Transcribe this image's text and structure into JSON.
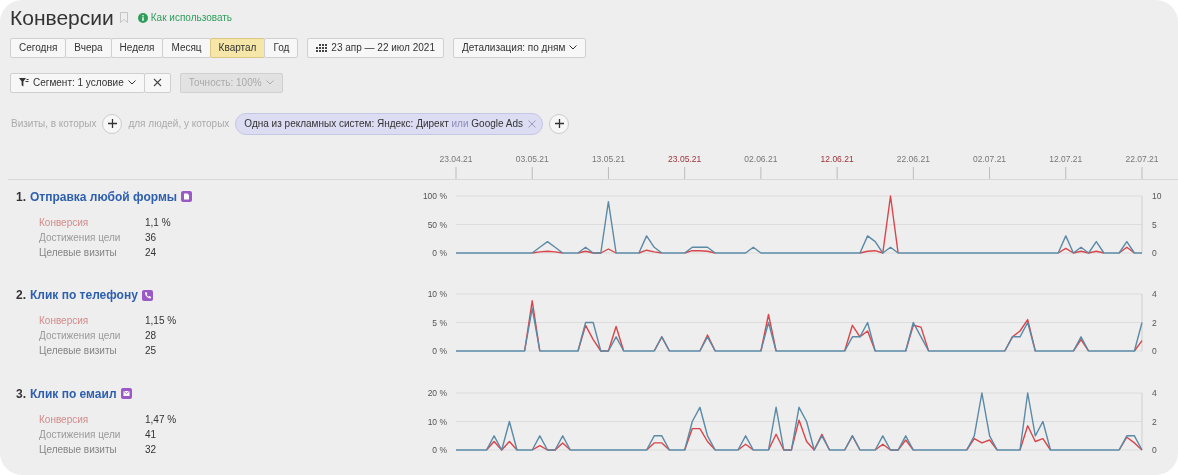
{
  "page": {
    "title": "Конверсии",
    "help_link": "Как использовать"
  },
  "periods": [
    {
      "label": "Сегодня",
      "selected": false
    },
    {
      "label": "Вчера",
      "selected": false
    },
    {
      "label": "Неделя",
      "selected": false
    },
    {
      "label": "Месяц",
      "selected": false
    },
    {
      "label": "Квартал",
      "selected": true
    },
    {
      "label": "Год",
      "selected": false
    }
  ],
  "date_range": "23 апр — 22 июл 2021",
  "detail": "Детализация: по дням",
  "segment": {
    "label": "Сегмент: 1 условие"
  },
  "precision": {
    "label": "Точность: 100%",
    "disabled": true
  },
  "filter": {
    "visits_label": "Визиты, в которых",
    "people_label": "для людей, у которых",
    "chip": [
      {
        "text": "Одна из рекламных систем: Яндекс: Директ",
        "kind": "value"
      },
      {
        "text": "или",
        "kind": "connector"
      },
      {
        "text": "Google Ads",
        "kind": "value"
      }
    ]
  },
  "date_axis": {
    "ticks": [
      {
        "label": "23.04.21",
        "holiday": false
      },
      {
        "label": "03.05.21",
        "holiday": false
      },
      {
        "label": "13.05.21",
        "holiday": false
      },
      {
        "label": "23.05.21",
        "holiday": true
      },
      {
        "label": "02.06.21",
        "holiday": false
      },
      {
        "label": "12.06.21",
        "holiday": true
      },
      {
        "label": "22.06.21",
        "holiday": false
      },
      {
        "label": "02.07.21",
        "holiday": false
      },
      {
        "label": "12.07.21",
        "holiday": false
      },
      {
        "label": "22.07.21",
        "holiday": false
      }
    ]
  },
  "goals": [
    {
      "number": "1.",
      "title": "Отправка любой формы",
      "kind": "form",
      "metrics": [
        {
          "label": "Конверсия",
          "value": "1,1 %",
          "color": "#d48a8a"
        },
        {
          "label": "Достижения цели",
          "value": "36",
          "color": "#9a9a9a"
        },
        {
          "label": "Целевые визиты",
          "value": "24",
          "color": "#858585"
        }
      ],
      "chart_data": {
        "type": "line",
        "ylim": [
          0,
          100
        ],
        "yticks": [
          {
            "value": 0,
            "label": "0 %"
          },
          {
            "value": 50,
            "label": "50 %"
          },
          {
            "value": 100,
            "label": "100 %"
          }
        ],
        "y2lim": [
          0,
          10
        ],
        "y2ticks": [
          0,
          5,
          10
        ],
        "series": [
          {
            "color": "#d9454a",
            "values": [
              null,
              null,
              null,
              null,
              null,
              null,
              null,
              null,
              null,
              null,
              0,
              2,
              3,
              2,
              0,
              null,
              0,
              3,
              0,
              0,
              7,
              0,
              null,
              null,
              0,
              5,
              2,
              0,
              null,
              null,
              0,
              4,
              4,
              3,
              0,
              null,
              null,
              null,
              null,
              null,
              null,
              null,
              null,
              null,
              null,
              null,
              null,
              null,
              null,
              null,
              null,
              null,
              null,
              0,
              3,
              4,
              0,
              100,
              0,
              null,
              null,
              null,
              null,
              null,
              null,
              null,
              null,
              null,
              null,
              null,
              null,
              null,
              null,
              null,
              null,
              null,
              null,
              null,
              null,
              0,
              8,
              0,
              3,
              0,
              3,
              0,
              null,
              0,
              10,
              0,
              null
            ]
          },
          {
            "color": "#5b8aa6",
            "axis": "y2",
            "values": [
              0,
              0,
              0,
              0,
              0,
              0,
              0,
              0,
              0,
              0,
              0,
              1,
              2,
              1,
              0,
              0,
              0,
              1,
              0,
              0,
              9,
              0,
              0,
              0,
              0,
              3,
              1,
              0,
              0,
              0,
              0,
              1,
              1,
              1,
              0,
              0,
              0,
              0,
              0,
              1,
              0,
              0,
              0,
              0,
              0,
              0,
              0,
              0,
              0,
              0,
              0,
              0,
              0,
              0,
              3,
              2,
              0,
              1,
              0,
              0,
              0,
              0,
              0,
              0,
              0,
              0,
              0,
              0,
              0,
              0,
              0,
              0,
              0,
              0,
              0,
              0,
              0,
              0,
              0,
              0,
              3,
              0,
              1,
              0,
              2,
              0,
              0,
              0,
              2,
              0,
              0
            ]
          }
        ]
      }
    },
    {
      "number": "2.",
      "title": "Клик по телефону",
      "kind": "phone",
      "metrics": [
        {
          "label": "Конверсия",
          "value": "1,15 %",
          "color": "#d48a8a"
        },
        {
          "label": "Достижения цели",
          "value": "28",
          "color": "#9a9a9a"
        },
        {
          "label": "Целевые визиты",
          "value": "25",
          "color": "#858585"
        }
      ],
      "chart_data": {
        "type": "line",
        "ylim": [
          0,
          10
        ],
        "yticks": [
          {
            "value": 0,
            "label": "0 %"
          },
          {
            "value": 5,
            "label": "5 %"
          },
          {
            "value": 10,
            "label": "10 %"
          }
        ],
        "y2lim": [
          0,
          4
        ],
        "y2ticks": [
          0,
          2,
          4
        ],
        "series": [
          {
            "color": "#d9454a",
            "values": [
              null,
              null,
              null,
              null,
              null,
              null,
              null,
              null,
              null,
              0,
              8.8,
              0,
              null,
              null,
              null,
              null,
              0,
              4.5,
              2,
              0,
              0,
              4.3,
              0,
              null,
              null,
              null,
              0,
              2.5,
              0,
              null,
              null,
              null,
              0,
              2.8,
              0,
              null,
              null,
              null,
              null,
              null,
              0,
              6.4,
              0,
              null,
              null,
              null,
              null,
              null,
              null,
              null,
              null,
              0,
              4.5,
              2.5,
              3.5,
              0,
              null,
              null,
              null,
              0,
              4.5,
              4.2,
              0,
              null,
              null,
              null,
              null,
              null,
              null,
              null,
              null,
              null,
              0,
              2.5,
              3.5,
              5.5,
              0,
              null,
              null,
              null,
              null,
              0,
              2,
              0,
              null,
              null,
              null,
              null,
              null,
              0,
              1.8
            ]
          },
          {
            "color": "#5b8aa6",
            "axis": "y2",
            "values": [
              0,
              0,
              0,
              0,
              0,
              0,
              0,
              0,
              0,
              0,
              3,
              0,
              0,
              0,
              0,
              0,
              0,
              2,
              2,
              0,
              0,
              1,
              0,
              0,
              0,
              0,
              0,
              1,
              0,
              0,
              0,
              0,
              0,
              1,
              0,
              0,
              0,
              0,
              0,
              0,
              0,
              2,
              0,
              0,
              0,
              0,
              0,
              0,
              0,
              0,
              0,
              0,
              1,
              1,
              2,
              0,
              0,
              0,
              0,
              0,
              2,
              1,
              0,
              0,
              0,
              0,
              0,
              0,
              0,
              0,
              0,
              0,
              0,
              1,
              1,
              2,
              0,
              0,
              0,
              0,
              0,
              0,
              1,
              0,
              0,
              0,
              0,
              0,
              0,
              0,
              2
            ]
          }
        ]
      }
    },
    {
      "number": "3.",
      "title": "Клик по емаил",
      "kind": "email",
      "metrics": [
        {
          "label": "Конверсия",
          "value": "1,47 %",
          "color": "#d48a8a"
        },
        {
          "label": "Достижения цели",
          "value": "41",
          "color": "#9a9a9a"
        },
        {
          "label": "Целевые визиты",
          "value": "32",
          "color": "#858585"
        }
      ],
      "chart_data": {
        "type": "line",
        "ylim": [
          0,
          20
        ],
        "yticks": [
          {
            "value": 0,
            "label": "0 %"
          },
          {
            "value": 10,
            "label": "10 %"
          },
          {
            "value": 20,
            "label": "20 %"
          }
        ],
        "y2lim": [
          0,
          4
        ],
        "y2ticks": [
          0,
          2,
          4
        ],
        "series": [
          {
            "color": "#d9454a",
            "values": [
              null,
              null,
              null,
              null,
              0,
              3,
              0,
              3,
              0,
              null,
              0,
              1.5,
              0,
              0,
              2.5,
              0,
              null,
              null,
              null,
              null,
              null,
              null,
              null,
              null,
              null,
              0,
              2.5,
              2.5,
              0,
              null,
              0,
              7.5,
              7.5,
              3,
              0,
              null,
              null,
              0,
              2,
              0,
              null,
              0,
              5.5,
              0,
              0,
              10.5,
              3,
              0,
              5.5,
              0,
              null,
              0,
              5,
              0,
              null,
              0,
              2,
              0,
              0,
              3.5,
              0,
              null,
              null,
              null,
              null,
              null,
              null,
              0,
              4,
              2.5,
              3.5,
              0,
              null,
              null,
              0,
              8.5,
              3,
              4,
              0,
              null,
              null,
              null,
              null,
              null,
              null,
              null,
              null,
              0,
              4.5,
              2.5,
              0
            ]
          },
          {
            "color": "#5b8aa6",
            "axis": "y2",
            "values": [
              0,
              0,
              0,
              0,
              0,
              1,
              0,
              2,
              0,
              0,
              0,
              1,
              0,
              0,
              1,
              0,
              0,
              0,
              0,
              0,
              0,
              0,
              0,
              0,
              0,
              0,
              1,
              1,
              0,
              0,
              0,
              2,
              3,
              1,
              0,
              0,
              0,
              0,
              1,
              0,
              0,
              0,
              3,
              0,
              0,
              3,
              2,
              0,
              1,
              0,
              0,
              0,
              1,
              0,
              0,
              0,
              1,
              0,
              0,
              1,
              0,
              0,
              0,
              0,
              0,
              0,
              0,
              0,
              1,
              4,
              1,
              0,
              0,
              0,
              0,
              4,
              1,
              2,
              0,
              0,
              0,
              0,
              0,
              0,
              0,
              0,
              0,
              0,
              1,
              1,
              0
            ]
          }
        ]
      }
    }
  ]
}
